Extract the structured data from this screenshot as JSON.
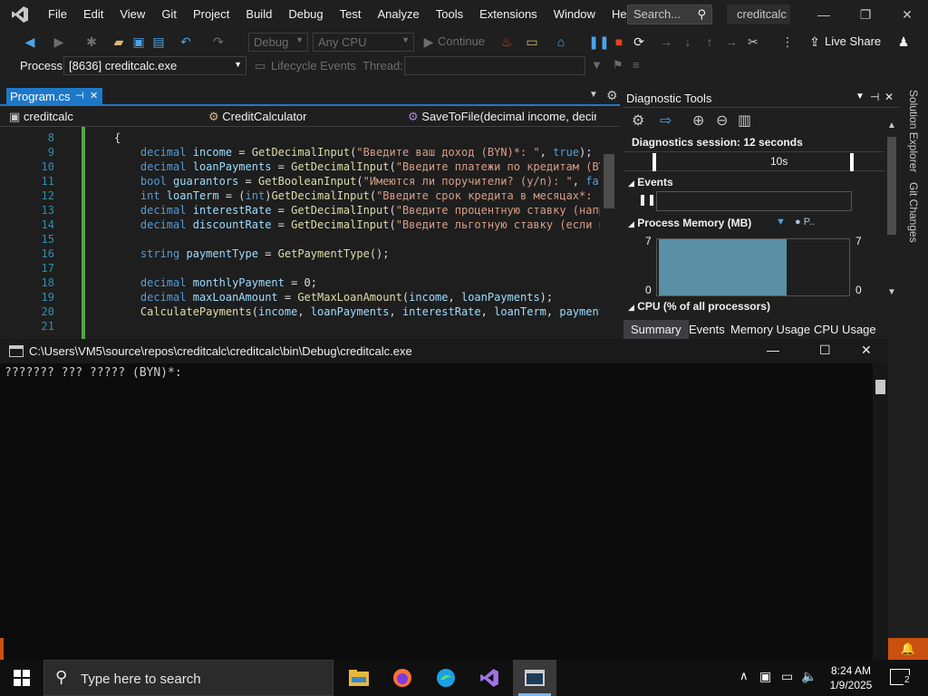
{
  "menubar": {
    "items": [
      "File",
      "Edit",
      "View",
      "Git",
      "Project",
      "Build",
      "Debug",
      "Test",
      "Analyze",
      "Tools",
      "Extensions",
      "Window",
      "Help"
    ],
    "search_placeholder": "Search...",
    "solution_name": "creditcalc"
  },
  "toolbar": {
    "config": "Debug",
    "platform": "Any CPU",
    "continue_label": "Continue",
    "live_share": "Live Share"
  },
  "processbar": {
    "label": "Process:",
    "process": "[8636] creditcalc.exe",
    "lifecycle": "Lifecycle Events",
    "thread": "Thread:"
  },
  "editor": {
    "tab": "Program.cs",
    "nav_project": "creditcalc",
    "nav_class": "CreditCalculator",
    "nav_member": "SaveToFile(decimal income, decim",
    "lines": [
      {
        "n": "8",
        "code": "{"
      },
      {
        "n": "9",
        "code": "    decimal income = GetDecimalInput(\"Введите ваш доход (BYN)*: \", true);"
      },
      {
        "n": "10",
        "code": "    decimal loanPayments = GetDecimalInput(\"Введите платежи по кредитам (BYN"
      },
      {
        "n": "11",
        "code": "    bool guarantors = GetBooleanInput(\"Имеются ли поручители? (y/n): \", false"
      },
      {
        "n": "12",
        "code": "    int loanTerm = (int)GetDecimalInput(\"Введите срок кредита в месяцах*: \","
      },
      {
        "n": "13",
        "code": "    decimal interestRate = GetDecimalInput(\"Введите процентную ставку (наприм"
      },
      {
        "n": "14",
        "code": "    decimal discountRate = GetDecimalInput(\"Введите льготную ставку (если име"
      },
      {
        "n": "15",
        "code": ""
      },
      {
        "n": "16",
        "code": "    string paymentType = GetPaymentType();"
      },
      {
        "n": "17",
        "code": ""
      },
      {
        "n": "18",
        "code": "    decimal monthlyPayment = 0;"
      },
      {
        "n": "19",
        "code": "    decimal maxLoanAmount = GetMaxLoanAmount(income, loanPayments);"
      },
      {
        "n": "20",
        "code": "    CalculatePayments(income, loanPayments, interestRate, loanTerm, paymentTy"
      },
      {
        "n": "21",
        "code": ""
      }
    ]
  },
  "diagnostics": {
    "title": "Diagnostic Tools",
    "session": "Diagnostics session: 12 seconds",
    "timeline_tick": "10s",
    "events_label": "Events",
    "memory_label": "Process Memory (MB)",
    "memory_legend": "P..",
    "memory_max": "7",
    "memory_min": "0",
    "memory_fill_fraction": 0.67,
    "cpu_label": "CPU (% of all processors)",
    "tabs": [
      "Summary",
      "Events",
      "Memory Usage",
      "CPU Usage"
    ]
  },
  "rail": {
    "solution_explorer": "Solution Explorer",
    "git_changes": "Git Changes"
  },
  "console": {
    "title": "C:\\Users\\VM5\\source\\repos\\creditcalc\\creditcalc\\bin\\Debug\\creditcalc.exe",
    "output": "??????? ??? ????? (BYN)*:"
  },
  "taskbar": {
    "search_placeholder": "Type here to search",
    "time": "8:24 AM",
    "date": "1/9/2025",
    "notification_count": "2"
  },
  "colors": {
    "accent": "#1e78c8",
    "keyword": "#569cd6",
    "string": "#d69d85",
    "memory_fill": "#5b8fa6"
  }
}
